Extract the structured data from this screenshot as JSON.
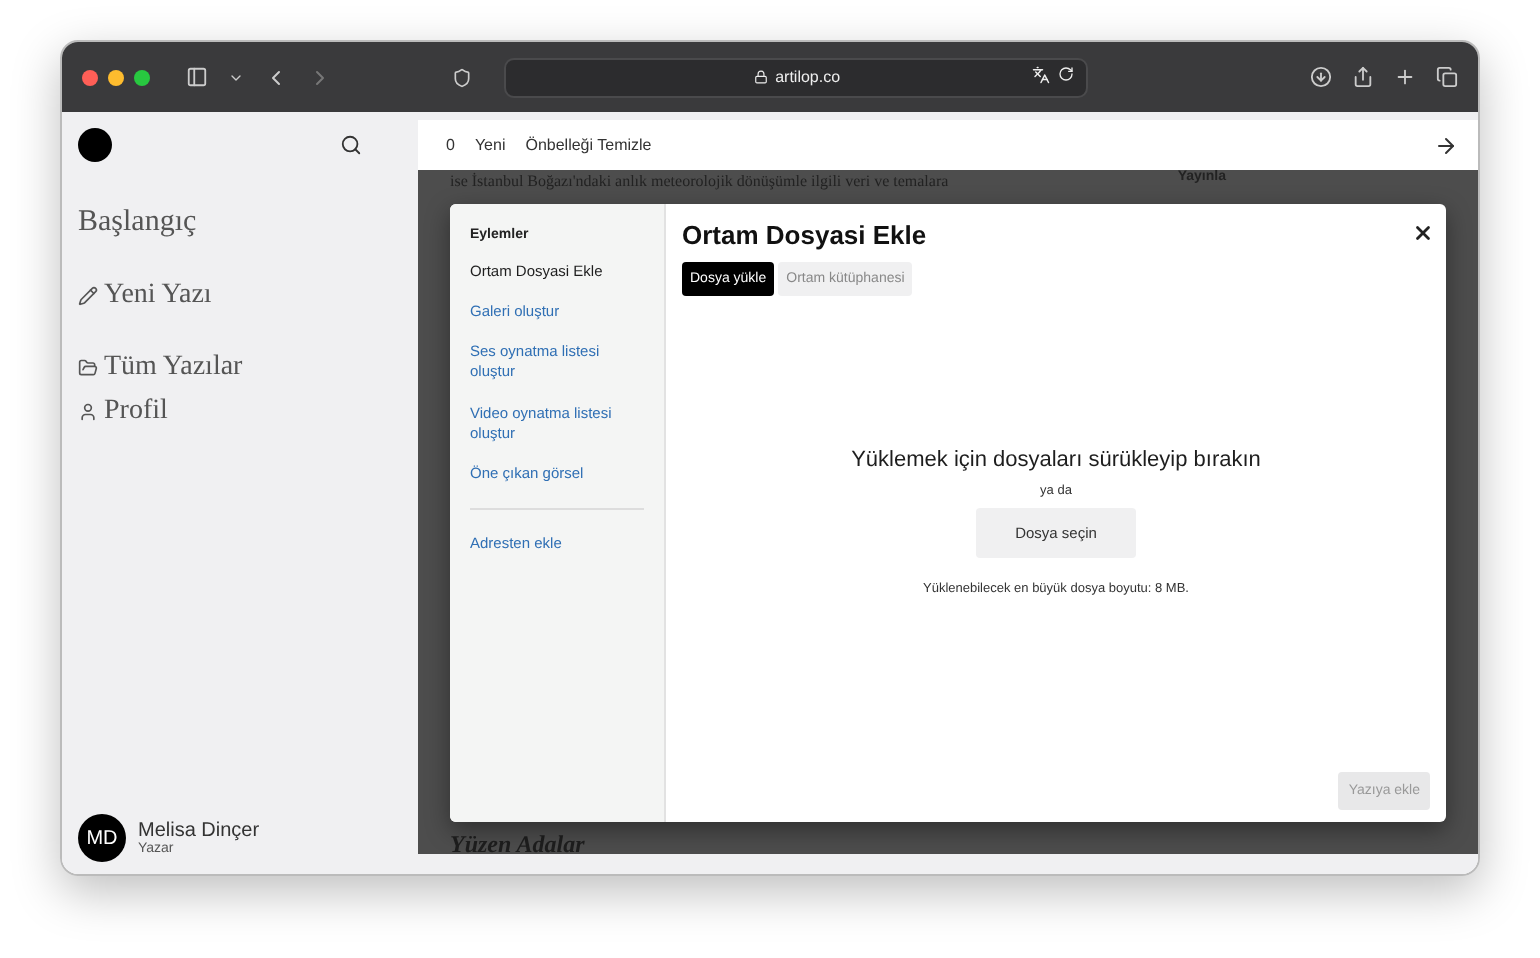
{
  "browser": {
    "url": "artilop.co"
  },
  "sidebar": {
    "items": [
      {
        "label": "Başlangıç",
        "selected": false
      },
      {
        "label": "Yeni Yazı",
        "selected": false
      },
      {
        "label": "Tüm Yazılar",
        "selected": false
      },
      {
        "label": "Profil",
        "selected": false
      }
    ],
    "user": {
      "initials": "MD",
      "name": "Melisa Dinçer",
      "role": "Yazar"
    }
  },
  "topbar": {
    "count": "0",
    "new_label": "Yeni",
    "clear_label": "Önbelleği Temizle"
  },
  "background": {
    "text": "ise İstanbul Boğazı'ndaki anlık meteorolojik dönüşümle ilgili veri ve temalara",
    "side_label": "Yayınla",
    "heading": "Yüzen Adalar"
  },
  "modal": {
    "actions_heading": "Eylemler",
    "actions": [
      {
        "label": "Ortam Dosyasi Ekle",
        "selected": true
      },
      {
        "label": "Galeri oluştur",
        "selected": false
      },
      {
        "label": "Ses oynatma listesi oluştur",
        "selected": false
      },
      {
        "label": "Video oynatma listesi oluştur",
        "selected": false
      },
      {
        "label": "Öne çıkan görsel",
        "selected": false
      }
    ],
    "url_action": "Adresten ekle",
    "title": "Ortam Dosyasi Ekle",
    "tabs": [
      {
        "label": "Dosya yükle",
        "selected": true
      },
      {
        "label": "Ortam kütüphanesi",
        "selected": false
      }
    ],
    "drop_heading": "Yüklemek için dosyaları sürükleyip bırakın",
    "or_text": "ya da",
    "select_button": "Dosya seçin",
    "max_size_note": "Yüklenebilecek en büyük dosya boyutu: 8 MB.",
    "insert_button": {
      "label": "Yazıya ekle",
      "disabled": true
    }
  }
}
